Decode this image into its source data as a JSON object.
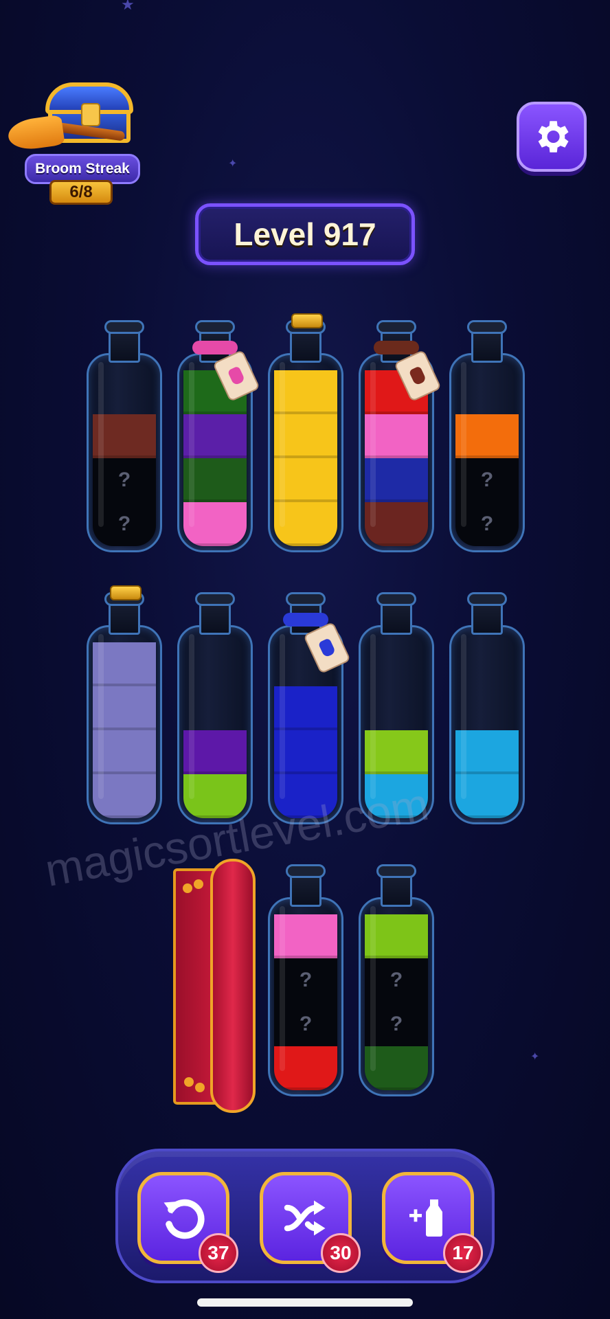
{
  "streak": {
    "title": "Broom Streak",
    "progress": "6/8"
  },
  "level": {
    "label": "Level 917"
  },
  "watermark": "magicsortlevel.com",
  "unknown_mark": "?",
  "bottles": [
    {
      "name": "bottle-1",
      "layers": [
        "hidden",
        "hidden",
        "#6e2a22"
      ],
      "cork": false,
      "tag": null
    },
    {
      "name": "bottle-2",
      "layers": [
        "#f263c4",
        "#1e5b1a",
        "#5b1fa8",
        "#1e6a1a"
      ],
      "cork": false,
      "tag": {
        "rope": "#e64aa8",
        "icon": "#e64aa8"
      }
    },
    {
      "name": "bottle-3",
      "layers": [
        "#f7c51a",
        "#f7c51a",
        "#f7c51a",
        "#f7c51a"
      ],
      "cork": true,
      "tag": null
    },
    {
      "name": "bottle-4",
      "layers": [
        "#6b2520",
        "#1e2aa6",
        "#f263c4",
        "#e01818"
      ],
      "cork": false,
      "tag": {
        "rope": "#6b2a1c",
        "icon": "#7a2a1e"
      }
    },
    {
      "name": "bottle-5",
      "layers": [
        "hidden",
        "hidden",
        "#f36d0c"
      ],
      "cork": false,
      "tag": null
    },
    {
      "name": "bottle-6",
      "layers": [
        "#7b78c2",
        "#7b78c2",
        "#7b78c2",
        "#7b78c2"
      ],
      "cork": true,
      "tag": null
    },
    {
      "name": "bottle-7",
      "layers": [
        "#7ac41a",
        "#5d18a8"
      ],
      "cork": false,
      "tag": null
    },
    {
      "name": "bottle-8",
      "layers": [
        "#1a22c8",
        "#1a22c8",
        "#1a22c8"
      ],
      "cork": false,
      "tag": {
        "rope": "#2a3ad8",
        "icon": "#2a3ad8"
      }
    },
    {
      "name": "bottle-9",
      "layers": [
        "#1ca6e0",
        "#86c81a"
      ],
      "cork": false,
      "tag": null
    },
    {
      "name": "bottle-10",
      "layers": [
        "#1ca6e0",
        "#1ca6e0"
      ],
      "cork": false,
      "tag": null
    },
    {
      "name": "bottle-11",
      "layers": [
        "#e01818",
        "hidden",
        "hidden",
        "#f263c4"
      ],
      "cork": false,
      "tag": null
    },
    {
      "name": "bottle-12",
      "layers": [
        "#1e5b1a",
        "hidden",
        "hidden",
        "#7ec418"
      ],
      "cork": false,
      "tag": null
    }
  ],
  "tools": [
    {
      "name": "undo",
      "icon": "undo-icon",
      "count": "37"
    },
    {
      "name": "shuffle",
      "icon": "shuffle-icon",
      "count": "30"
    },
    {
      "name": "add-bottle",
      "icon": "add-bottle-icon",
      "count": "17"
    }
  ]
}
